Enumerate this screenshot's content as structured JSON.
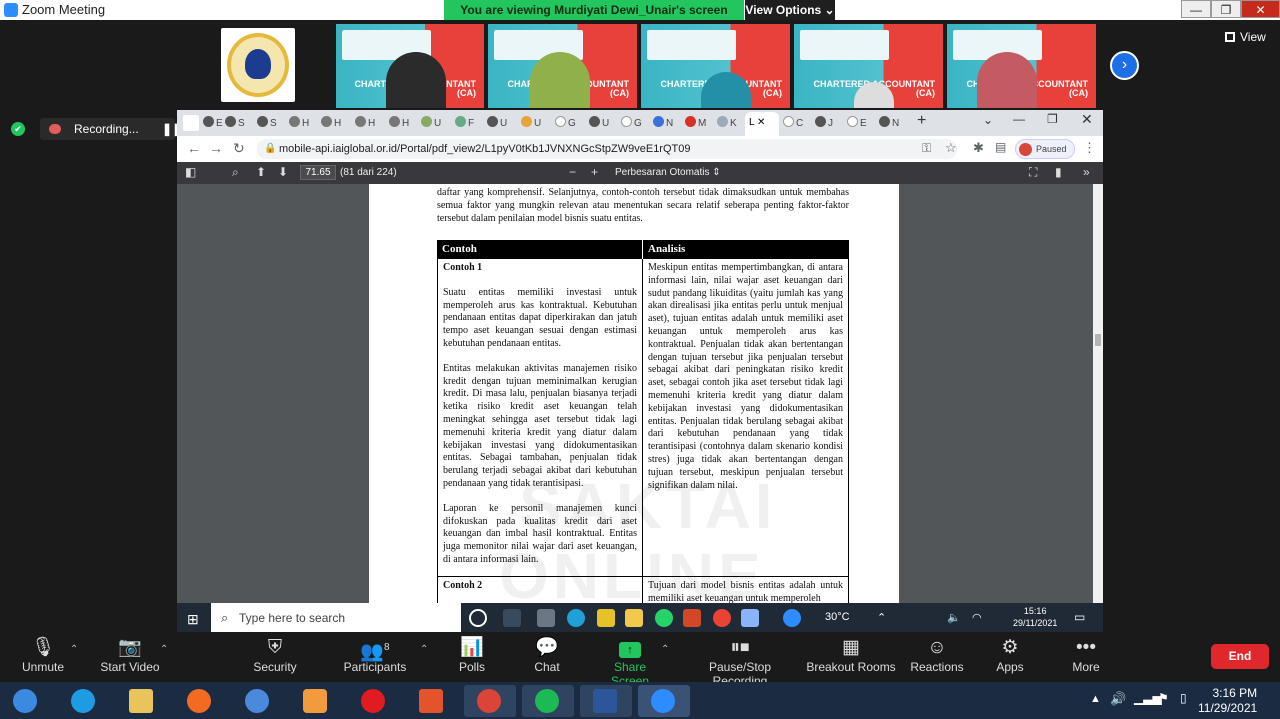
{
  "zoom": {
    "window_title": "Zoom Meeting",
    "viewing_banner": "You are viewing Murdiyati Dewi_Unair's screen",
    "view_options": "View Options",
    "view_button": "View",
    "recording_label": "Recording...",
    "thumbnail_label": "CHARTERED ACCOUNTANT (CA)",
    "controls": {
      "unmute": "Unmute",
      "start_video": "Start Video",
      "security": "Security",
      "participants": "Participants",
      "participants_count": "8",
      "polls": "Polls",
      "chat": "Chat",
      "share_screen": "Share Screen",
      "pause_recording": "Pause/Stop Recording",
      "breakout_rooms": "Breakout Rooms",
      "reactions": "Reactions",
      "apps": "Apps",
      "more": "More",
      "end": "End"
    }
  },
  "browser": {
    "url": "mobile-api.iaiglobal.or.id/Portal/pdf_view2/L1pyV0tKb1JVNXNGcStpZW9veE1rQT09",
    "profile_status": "Paused",
    "tabs": [
      "E",
      "S",
      "S",
      "H",
      "H",
      "H",
      "H",
      "U",
      "F",
      "U",
      "U",
      "G",
      "U",
      "G",
      "N",
      "M",
      "K",
      "C",
      "L",
      "C",
      "J",
      "E",
      "N"
    ],
    "active_tab_letter": "L"
  },
  "pdf": {
    "page_number": "71.65",
    "page_count": "(81 dari 224)",
    "zoom": "Perbesaran Otomatis",
    "intro": "daftar yang komprehensif. Selanjutnya, contoh-contoh tersebut tidak dimaksudkan untuk membahas semua faktor yang mungkin relevan atau menentukan secara relatif seberapa penting faktor-faktor tersebut dalam penilaian model bisnis suatu entitas.",
    "table": {
      "header_left": "Contoh",
      "header_right": "Analisis",
      "example1_title": "Contoh 1",
      "left_p1": "Suatu entitas memiliki investasi untuk memperoleh arus kas kontraktual. Kebutuhan pendanaan entitas dapat diperkirakan dan jatuh tempo aset keuangan sesuai dengan estimasi kebutuhan pendanaan entitas.",
      "left_p2": "Entitas melakukan aktivitas manajemen risiko kredit dengan tujuan meminimalkan kerugian kredit. Di masa lalu, penjualan biasanya terjadi ketika risiko kredit aset keuangan telah meningkat sehingga aset tersebut tidak lagi memenuhi kriteria kredit yang diatur dalam kebijakan investasi yang didokumentasikan entitas. Sebagai tambahan, penjualan tidak berulang terjadi sebagai akibat dari kebutuhan pendanaan yang tidak terantisipasi.",
      "left_p3": "Laporan ke personil manajemen kunci difokuskan pada kualitas kredit dari aset keuangan dan imbal hasil kontraktual. Entitas juga memonitor nilai wajar dari aset keuangan, di antara informasi lain.",
      "right_p1": "Meskipun entitas mempertimbangkan, di antara informasi lain, nilai wajar aset keuangan dari sudut pandang likuiditas (yaitu jumlah kas yang akan direalisasi jika entitas perlu untuk menjual aset), tujuan entitas adalah untuk memiliki aset keuangan untuk memperoleh arus kas kontraktual. Penjualan tidak akan bertentangan dengan tujuan tersebut jika penjualan tersebut sebagai akibat dari peningkatan risiko kredit aset, sebagai contoh jika aset tersebut tidak lagi memenuhi kriteria kredit yang diatur dalam kebijakan investasi yang didokumentasikan entitas. Penjualan tidak berulang sebagai akibat dari kebutuhan pendanaan yang tidak terantisipasi (contohnya dalam skenario kondisi stres) juga tidak akan bertentangan dengan tujuan tersebut, meskipun penjualan tersebut signifikan dalam nilai.",
      "example2_title": "Contoh 2",
      "right_row2": "Tujuan dari model bisnis entitas adalah untuk memiliki aset keuangan untuk memperoleh"
    }
  },
  "shared_taskbar": {
    "search_placeholder": "Type here to search",
    "temperature": "30°C",
    "time": "15:16",
    "date": "29/11/2021"
  },
  "host_taskbar": {
    "time": "3:16 PM",
    "date": "11/29/2021"
  }
}
